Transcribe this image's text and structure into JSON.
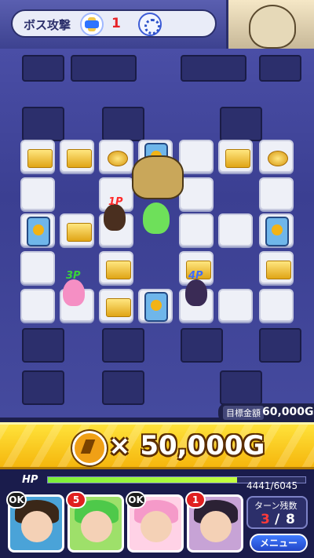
{
  "boss": {
    "label": "ボス攻撃",
    "count": "1",
    "icon1": "cross-arrows-icon",
    "icon2": "gear-emblem-icon"
  },
  "target": {
    "label": "目標金額",
    "value": "60,000G"
  },
  "reward": {
    "text": "× 50,000G",
    "icon": "gold-coin-icon"
  },
  "hp": {
    "label": "HP",
    "text": "4441/6045",
    "current": 4441,
    "max": 6045
  },
  "players": {
    "p1": "1P",
    "p3": "3P",
    "p4": "4P"
  },
  "party": [
    {
      "badge": "OK",
      "badge_color": "black",
      "hair": "#3a2718",
      "bg": "#4aa3d8"
    },
    {
      "badge": "5",
      "badge_color": "red",
      "hair": "#4ec94a",
      "bg": "#9ee06a"
    },
    {
      "badge": "OK",
      "badge_color": "black",
      "hair": "#f59ac9",
      "bg": "#ffd2e6"
    },
    {
      "badge": "1",
      "badge_color": "red",
      "hair": "#2b2134",
      "bg": "#c7a3d6"
    }
  ],
  "turn": {
    "label": "ターン残数",
    "current": "3",
    "separator": "/",
    "total": "8"
  },
  "menu": {
    "label": "メニュー"
  },
  "colors": {
    "accent_gold": "#f5b60d",
    "board": "#3b3f92",
    "hp_green": "#7af03a",
    "turn_red": "#ff3a3a"
  }
}
